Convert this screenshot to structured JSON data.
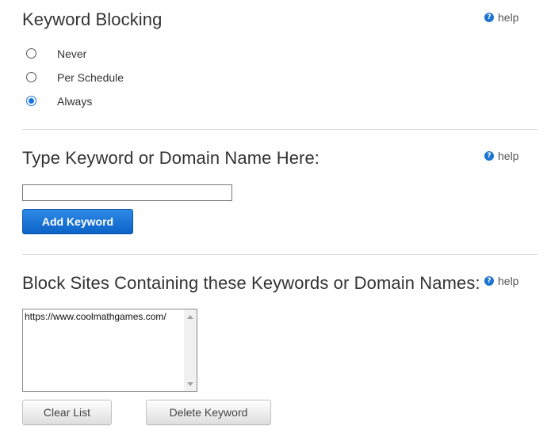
{
  "keyword_blocking": {
    "title": "Keyword Blocking",
    "help_label": "help",
    "help_icon": "question-circle-icon",
    "options": [
      {
        "label": "Never",
        "selected": false
      },
      {
        "label": "Per Schedule",
        "selected": false
      },
      {
        "label": "Always",
        "selected": true
      }
    ]
  },
  "add_keyword": {
    "title": "Type Keyword or Domain Name Here:",
    "help_label": "help",
    "input_value": "",
    "button_label": "Add Keyword"
  },
  "blocked_list": {
    "title": "Block Sites Containing these Keywords or Domain Names:",
    "help_label": "help",
    "items": [
      "https://www.coolmathgames.com/"
    ],
    "clear_button_label": "Clear List",
    "delete_button_label": "Delete Keyword"
  },
  "colors": {
    "accent": "#1d74d1",
    "primary_button": "#0c63c8",
    "text": "#333333",
    "divider": "#d8d8d8"
  }
}
